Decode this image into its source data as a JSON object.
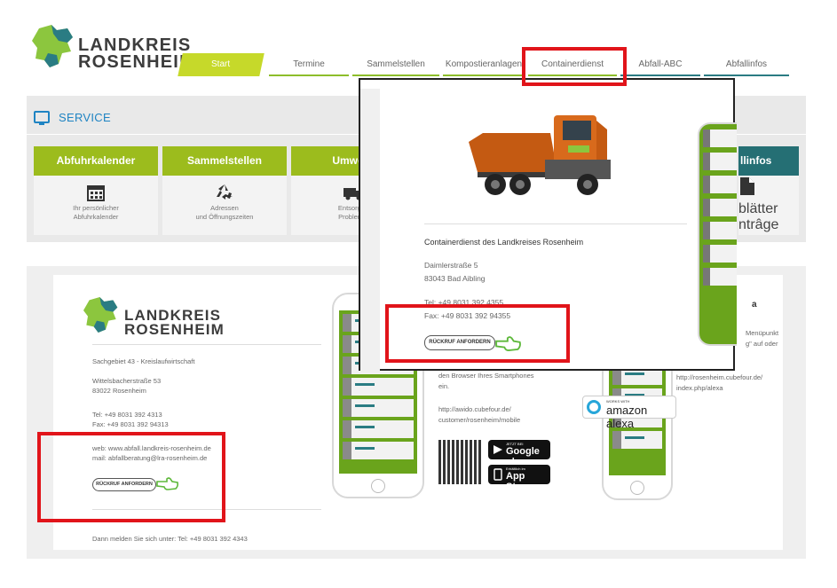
{
  "header": {
    "logo_line1": "LANDKREIS",
    "logo_line2": "ROSENHEIM",
    "nav": [
      "Start",
      "Termine",
      "Sammelstellen",
      "Kompostieranlagen",
      "Containerdienst",
      "Abfall-ABC",
      "Abfallinfos"
    ]
  },
  "service": {
    "title": "SERVICE",
    "tiles": [
      {
        "title": "Abfuhrkalender",
        "icon": "calendar-icon",
        "sub1": "Ihr persönlicher",
        "sub2": "Abfuhrkalender"
      },
      {
        "title": "Sammelstellen",
        "icon": "recycle-icon",
        "sub1": "Adressen",
        "sub2": "und Öffnungszeiten"
      },
      {
        "title": "Umweltr",
        "icon": "truck-icon",
        "sub1": "Entsorgun",
        "sub2": "Problemst"
      }
    ],
    "partial_tile": {
      "title": "llinfos",
      "sub1": "blätter",
      "sub2": "ntrâge"
    }
  },
  "contact": {
    "logo_line1": "LANDKREIS",
    "logo_line2": "ROSENHEIM",
    "dept": "Sachgebiet 43 - Kreislaufwirtschaft",
    "street": "Wittelsbacherstraße 53",
    "city": "83022 Rosenheim",
    "tel": "Tel:  +49 8031 392 4313",
    "fax": "Fax: +49 8031 392 94313",
    "web": "web: www.abfall.landkreis-rosenheim.de",
    "mail": "mail: abfallberatung@lra-rosenheim.de",
    "callback_label": "RÜCKRUF ANFORDERN",
    "signup": "Dann melden Sie sich unter: Tel: +49 8031 392 4343",
    "mid_text1": "den Browser Ihres Smartphones",
    "mid_text2": "ein.",
    "app_url1": "http://awido.cubefour.de/",
    "app_url2": "customer/rosenheim/mobile",
    "google_small": "JETZT BEI",
    "google_big": "Google play",
    "apple_small": "Erhältlich im",
    "apple_big": "App Store",
    "alexa_small": "WORKS WITH",
    "alexa_big": "amazon alexa",
    "right_text1": "Menüpunkt",
    "right_text2": "g\" auf oder",
    "right_url1": "http://rosenheim.cubefour.de/",
    "right_url2": "index.php/alexa",
    "right_partial": "a"
  },
  "popup": {
    "title": "Containerdienst des Landkreises Rosenheim",
    "street": "Daimlerstraße 5",
    "city": "83043 Bad Aibling",
    "tel": "Tel:  +49 8031 392 4355",
    "fax": "Fax: +49 8031 392 94355",
    "callback_label": "RÜCKRUF ANFORDERN"
  },
  "colors": {
    "brand_green": "#9cbc1d",
    "brand_teal": "#256f74",
    "accent_blue": "#1f84c3",
    "highlight_red": "#e1141a"
  }
}
